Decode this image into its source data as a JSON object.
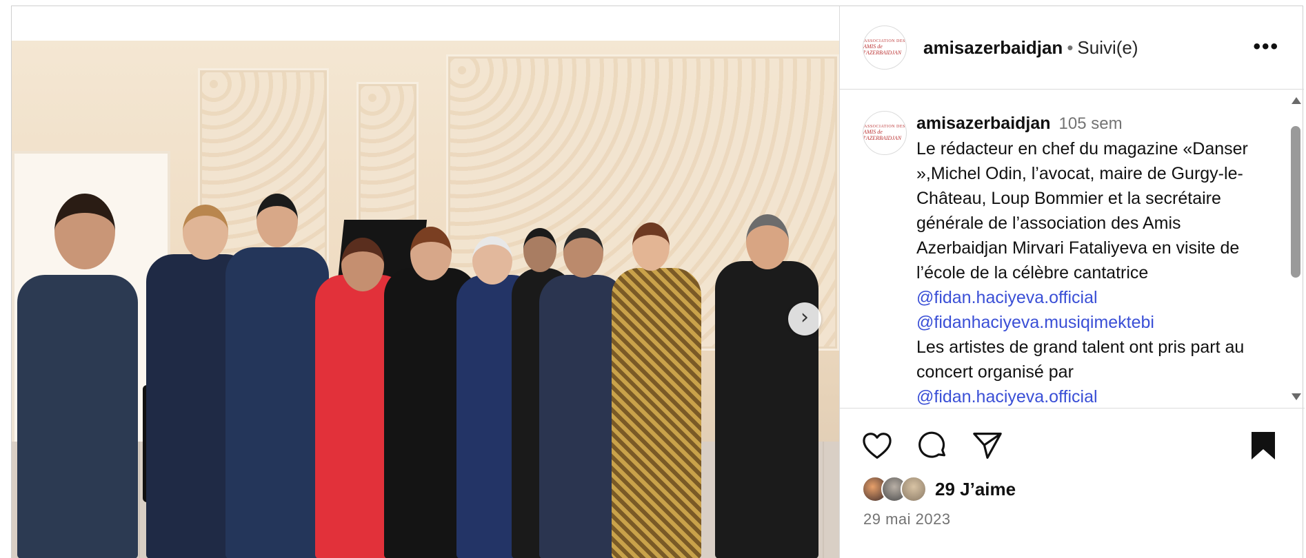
{
  "post": {
    "username": "amisazerbaidjan",
    "separator": "•",
    "follow_status": "Suivi(e)",
    "more_label": "•••",
    "avatar_text_line1": "ASSOCIATION DES",
    "avatar_text_line2": "AMIS de l'AZERBAIDJAN"
  },
  "caption": {
    "username": "amisazerbaidjan",
    "time": "105 sem",
    "text1": "Le rédacteur en chef du magazine «Danser »,Michel Odin, l’avocat, maire de Gurgy-le-Château, Loup Bommier et la secrétaire générale de l’association des Amis Azerbaidjan Mirvari Fataliyeva en visite de l’école de la célèbre cantatrice ",
    "mention1": "@fidan.haciyeva.official",
    "mention2": "@fidanhaciyeva.musiqimektebi",
    "text2": "Les artistes de grand talent ont pris part au concert organisé par",
    "mention3": "@fidan.haciyeva.official"
  },
  "actions": {
    "likes": "29 J’aime",
    "date": "29 mai 2023"
  },
  "media": {
    "next_icon": "›"
  },
  "icons": [
    "heart-icon",
    "comment-icon",
    "share-icon",
    "bookmark-icon",
    "chevron-right-icon",
    "more-icon"
  ],
  "colors": {
    "mention": "#3a4fd6",
    "muted": "#737373",
    "border": "#dbdbdb"
  }
}
